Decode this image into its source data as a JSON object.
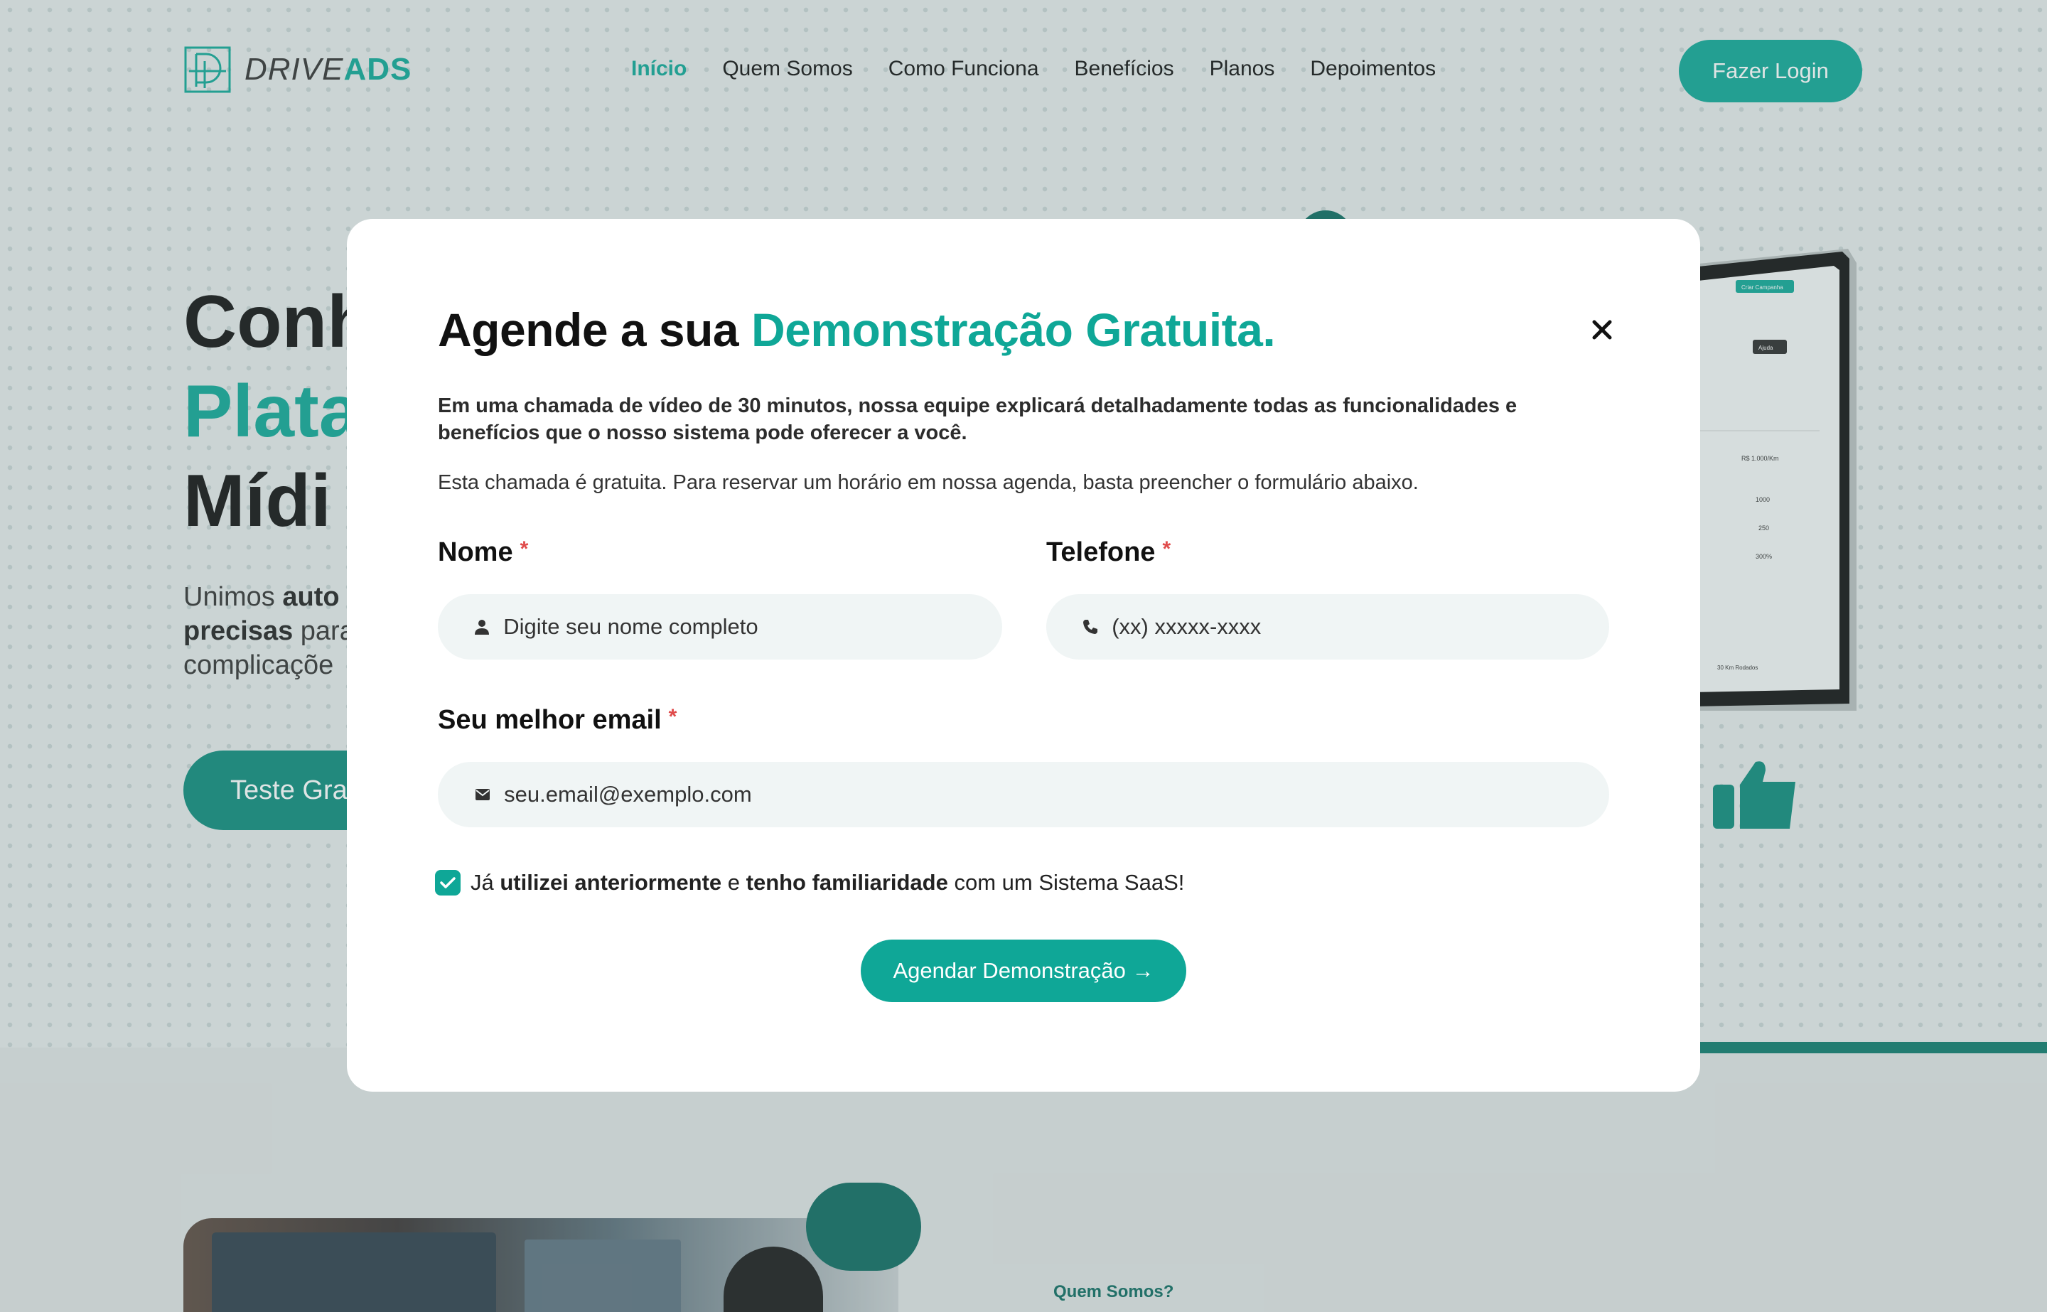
{
  "brand": {
    "part1": "DRIVE",
    "part2": "ADS",
    "color": "#0fa797"
  },
  "nav": {
    "items": [
      {
        "label": "Início",
        "active": true
      },
      {
        "label": "Quem Somos"
      },
      {
        "label": "Como Funciona"
      },
      {
        "label": "Benefícios"
      },
      {
        "label": "Planos"
      },
      {
        "label": "Depoimentos"
      }
    ],
    "login_label": "Fazer Login"
  },
  "hero": {
    "line1": "Conh",
    "line2": "Plata",
    "line3": "Mídi",
    "p_prefix1": "Unimos ",
    "p_bold1": "auto",
    "p_bold2": "precisas",
    "p_mid": " para",
    "p_line3": "complicaçõe",
    "cta_label": "Teste Gra"
  },
  "modal": {
    "title_prefix": "Agende a sua ",
    "title_accent": "Demonstração Gratuita.",
    "desc1": "Em uma chamada de vídeo de 30 minutos, nossa equipe explicará detalhadamente todas as funcionalidades e benefícios que o nosso sistema pode oferecer a você.",
    "desc2": "Esta chamada é gratuita. Para reservar um horário em nossa agenda, basta preencher o formulário abaixo.",
    "fields": {
      "name": {
        "label": "Nome",
        "placeholder": "Digite seu nome completo",
        "required": "*"
      },
      "phone": {
        "label": "Telefone",
        "placeholder": "(xx) xxxxx-xxxx",
        "required": "*"
      },
      "email": {
        "label": "Seu melhor email",
        "placeholder": "seu.email@exemplo.com",
        "required": "*"
      }
    },
    "checkbox": {
      "checked": true,
      "t1": "Já ",
      "b1": "utilizei anteriormente",
      "t2": " e ",
      "b2": "tenho familiaridade",
      "t3": " com um Sistema SaaS!"
    },
    "submit_label": "Agendar Demonstração →",
    "close_icon": "close-icon"
  },
  "laptop_screen": {
    "btn1": "Criar Campanha",
    "btn2": "Ajuda",
    "v1": "R$ 1.000/Km",
    "v2": "1000",
    "v3": "250",
    "v4": "300%",
    "v5": "30 Km Rodados"
  },
  "about": {
    "label": "Quem Somos?"
  }
}
